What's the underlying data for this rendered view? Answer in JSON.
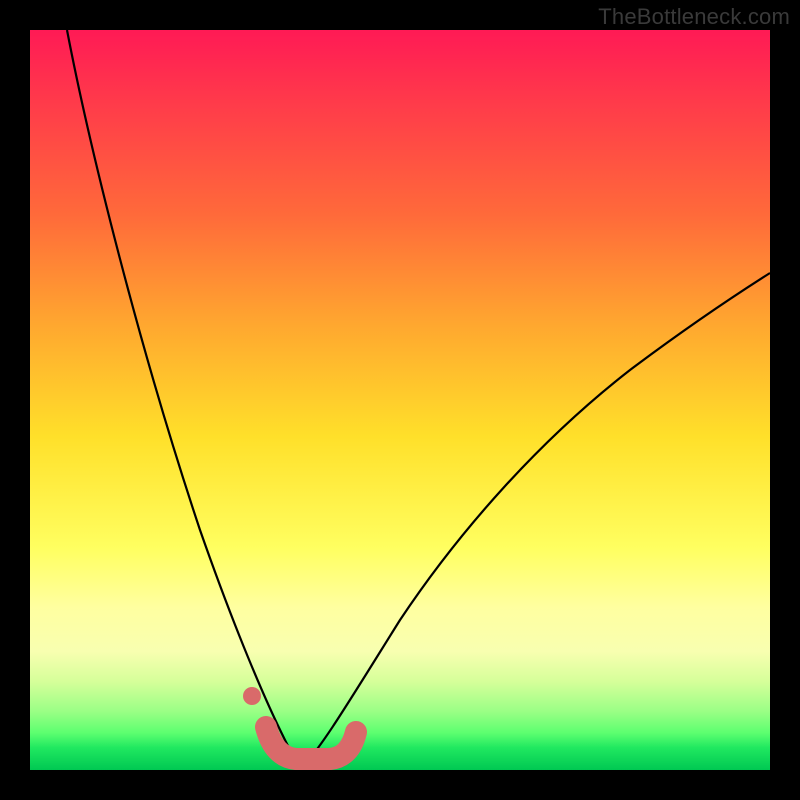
{
  "watermark": "TheBottleneck.com",
  "colors": {
    "marker": "#d96a6a",
    "curve": "#000000"
  },
  "chart_data": {
    "type": "line",
    "title": "",
    "xlabel": "",
    "ylabel": "",
    "xlim": [
      0,
      100
    ],
    "ylim": [
      0,
      100
    ],
    "grid": false,
    "legend": false,
    "background_gradient": {
      "top_color": "#ff1a55",
      "bottom_color": "#00c852",
      "meaning": "red high / green low (bottleneck severity)"
    },
    "series": [
      {
        "name": "left-branch",
        "x": [
          5,
          7,
          10,
          13,
          16,
          19,
          22,
          25,
          27,
          29,
          31,
          32.5,
          34,
          35,
          36
        ],
        "y": [
          100,
          90,
          76,
          63,
          51,
          40,
          30,
          21,
          15,
          10,
          6,
          3.5,
          1.8,
          0.8,
          0.3
        ]
      },
      {
        "name": "right-branch",
        "x": [
          36,
          38,
          41,
          45,
          50,
          56,
          63,
          71,
          80,
          90,
          100
        ],
        "y": [
          0.3,
          1.5,
          4,
          9,
          16,
          24,
          33,
          42,
          51,
          60,
          68
        ]
      }
    ],
    "annotations": {
      "optimal_range_x": [
        31,
        42
      ],
      "optimal_marker_dot_x": 29.5,
      "optimal_marker_dot_y": 9
    }
  }
}
